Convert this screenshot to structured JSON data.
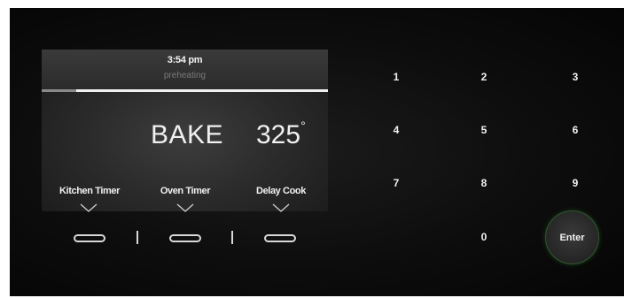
{
  "display": {
    "time": "3:54 pm",
    "status": "preheating",
    "progress_fraction": 0.12,
    "mode": "BAKE",
    "temperature": "325",
    "degree_symbol": "°"
  },
  "soft_keys": [
    {
      "label": "Kitchen Timer",
      "icon": "chevron-down-icon"
    },
    {
      "label": "Oven Timer",
      "icon": "chevron-down-icon"
    },
    {
      "label": "Delay Cook",
      "icon": "chevron-down-icon"
    }
  ],
  "keypad": {
    "keys": [
      "1",
      "2",
      "3",
      "4",
      "5",
      "6",
      "7",
      "8",
      "9",
      "0"
    ],
    "enter_label": "Enter",
    "enter_ring_color": "#2e5a2e"
  }
}
